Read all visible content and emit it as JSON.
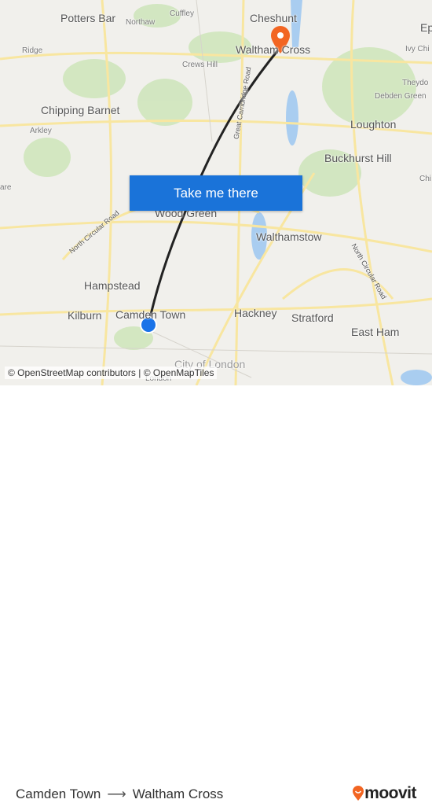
{
  "map": {
    "labels": {
      "potters_bar": "Potters Bar",
      "cuffley": "Cuffley",
      "northaw": "Northaw",
      "cheshunt": "Cheshunt",
      "epping": "Ep",
      "ridge": "Ridge",
      "crews_hill": "Crews Hill",
      "waltham_cross": "Waltham Cross",
      "ivy_chimneys": "Ivy Chi",
      "theydon": "Theydo",
      "debden_green": "Debden Green",
      "chipping_barnet": "Chipping Barnet",
      "great_cambridge_road": "Great Cambridge Road",
      "arkley": "Arkley",
      "loughton": "Loughton",
      "buckhurst_hill": "Buckhurst Hill",
      "edgware": "are",
      "chigwell": "Chi",
      "wood_green": "Wood Green",
      "north_circular_1": "North Circular Road",
      "north_circular_2": "North Circular Road",
      "walthamstow": "Walthamstow",
      "hampstead": "Hampstead",
      "kilburn": "Kilburn",
      "camden_town": "Camden Town",
      "hackney": "Hackney",
      "stratford": "Stratford",
      "east_ham": "East Ham",
      "city_of_london": "City of London",
      "london": "London"
    },
    "cta_label": "Take me there",
    "attribution": "© OpenStreetMap contributors | © OpenMapTiles",
    "origin_marker_color": "#1a73e8",
    "destination_marker_color": "#f26522",
    "route_color": "#222222"
  },
  "footer": {
    "origin": "Camden Town",
    "arrow": "⟶",
    "destination": "Waltham Cross",
    "logo": "moovit",
    "brand_color": "#f26522"
  }
}
